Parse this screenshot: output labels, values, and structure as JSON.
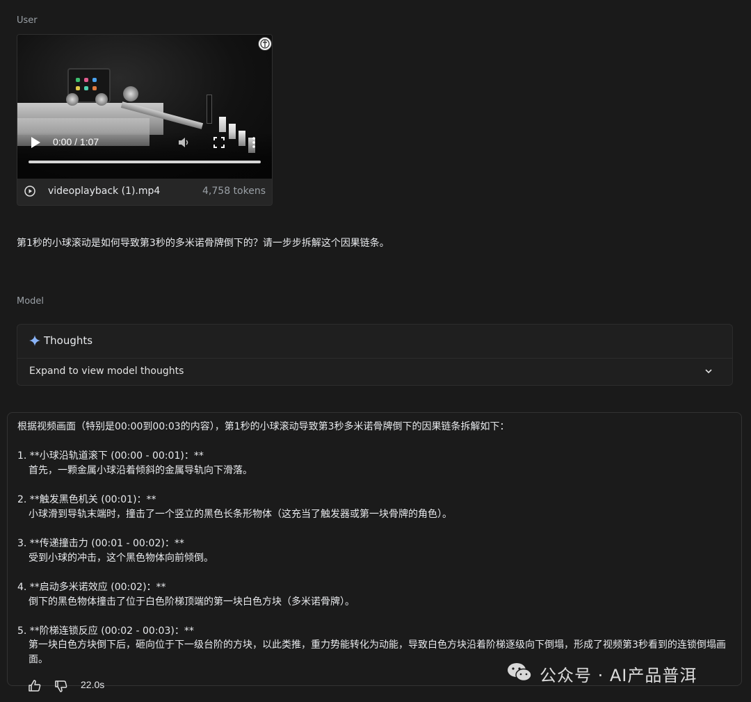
{
  "user_label": "User",
  "model_label": "Model",
  "video": {
    "time": "0:00 / 1:07",
    "progress": 0,
    "file_name": "videoplayback (1).mp4",
    "tokens": "4,758 tokens"
  },
  "prompt": "第1秒的小球滚动是如何导致第3秒的多米诺骨牌倒下的？请一步步拆解这个因果链条。",
  "thoughts": {
    "title": "Thoughts",
    "expand_label": "Expand to view model thoughts"
  },
  "response": {
    "intro": "根据视频画面（特别是00:00到00:03的内容），第1秒的小球滚动导致第3秒多米诺骨牌倒下的因果链条拆解如下：",
    "steps": [
      {
        "heading": "1.  **小球沿轨道滚下 (00:00 - 00:01)：**",
        "body": "首先，一颗金属小球沿着倾斜的金属导轨向下滑落。"
      },
      {
        "heading": "2.  **触发黑色机关 (00:01)：**",
        "body": "小球滑到导轨末端时，撞击了一个竖立的黑色长条形物体（这充当了触发器或第一块骨牌的角色）。"
      },
      {
        "heading": "3.  **传递撞击力 (00:01 - 00:02)：**",
        "body": "受到小球的冲击，这个黑色物体向前倾倒。"
      },
      {
        "heading": "4.  **启动多米诺效应 (00:02)：**",
        "body": "倒下的黑色物体撞击了位于白色阶梯顶端的第一块白色方块（多米诺骨牌）。"
      },
      {
        "heading": "5.  **阶梯连锁反应 (00:02 - 00:03)：**",
        "body": "第一块白色方块倒下后，砸向位于下一级台阶的方块，以此类推，重力势能转化为动能，导致白色方块沿着阶梯逐级向下倒塌，形成了视频第3秒看到的连锁倒塌画面。"
      }
    ]
  },
  "feedback": {
    "elapsed": "22.0s"
  },
  "watermark": "公众号 · AI产品普洱",
  "colors": {
    "background": "#1a1a1a",
    "accent_spark": "#8ab4f8"
  }
}
